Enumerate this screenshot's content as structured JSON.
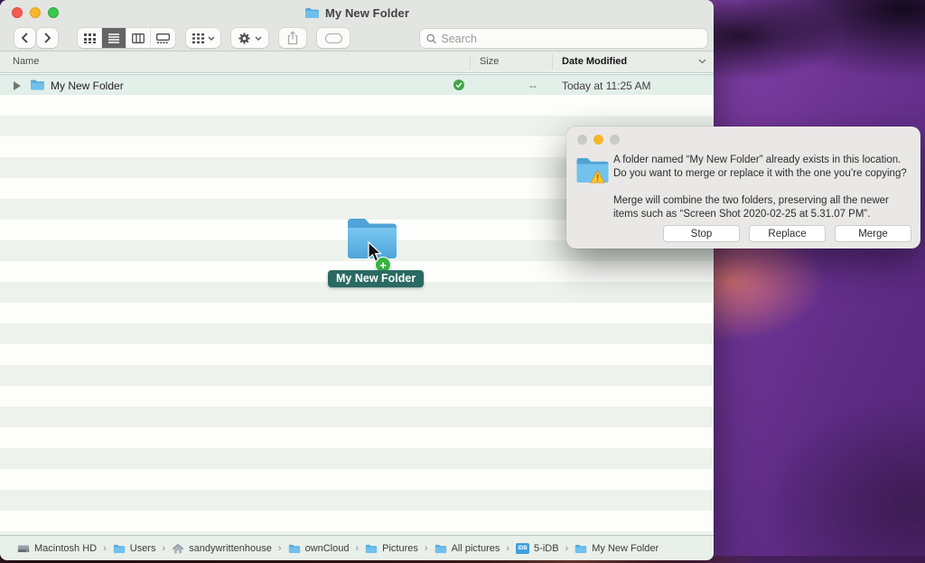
{
  "window": {
    "title": "My New Folder",
    "toolbar": {
      "search_placeholder": "Search"
    },
    "columns": {
      "name": "Name",
      "size": "Size",
      "date_modified": "Date Modified"
    },
    "row": {
      "name": "My New Folder",
      "size": "--",
      "date_modified": "Today at 11:25 AM"
    },
    "path_items": [
      {
        "label": "Macintosh HD",
        "icon": "drive"
      },
      {
        "label": "Users",
        "icon": "folder"
      },
      {
        "label": "sandywrittenhouse",
        "icon": "home"
      },
      {
        "label": "ownCloud",
        "icon": "folder"
      },
      {
        "label": "Pictures",
        "icon": "folder"
      },
      {
        "label": "All pictures",
        "icon": "folder"
      },
      {
        "label": "5-iDB",
        "icon": "idb",
        "icon_text": "iDB"
      },
      {
        "label": "My New Folder",
        "icon": "folder"
      }
    ]
  },
  "drag": {
    "label": "My New Folder",
    "plus": "+"
  },
  "dialog": {
    "message_1": "A folder named “My New Folder” already exists in this location. Do you want to merge or replace it with the one you’re copying?",
    "message_2": "Merge will combine the two folders, preserving all the newer items such as “Screen Shot 2020-02-25 at 5.31.07 PM”.",
    "buttons": {
      "stop": "Stop",
      "replace": "Replace",
      "merge": "Merge"
    }
  },
  "colors": {
    "folder_blue": "#5fb3e4",
    "drag_pill_teal": "#2a6a62",
    "plus_badge_green": "#36b33f",
    "check_badge_green": "#3fa547",
    "warning_yellow": "#f8c630",
    "wallpaper_purple": "#8a47ad"
  }
}
